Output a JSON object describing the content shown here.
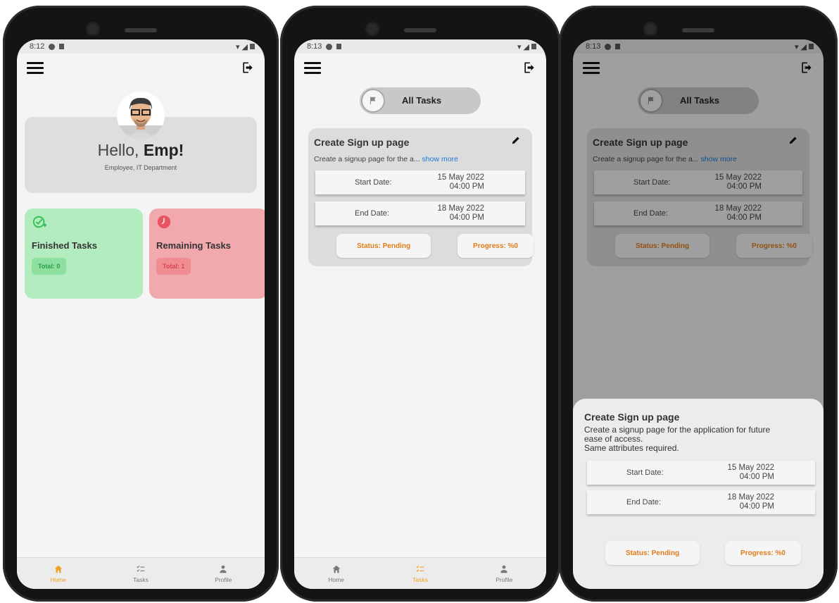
{
  "status": {
    "time1": "8:12",
    "time2": "8:13",
    "time3": "8:13"
  },
  "home": {
    "greeting": "Hello,",
    "name": "Emp!",
    "subtitle": "Employee, IT Department",
    "finished": {
      "title": "Finished Tasks",
      "total": "Total: 0"
    },
    "remaining": {
      "title": "Remaining Tasks",
      "total": "Total: 1"
    }
  },
  "nav": {
    "home": "Home",
    "tasks": "Tasks",
    "profile": "Profile"
  },
  "tasks": {
    "filter": "All Tasks",
    "card": {
      "title": "Create Sign up page",
      "desc": "Create a signup page for the a...",
      "show_more": "show more",
      "start_label": "Start Date:",
      "start_date": "15 May 2022",
      "start_time": "04:00 PM",
      "end_label": "End Date:",
      "end_date": "18 May 2022",
      "end_time": "04:00 PM",
      "status": "Status: Pending",
      "progress": "Progress: %0"
    }
  },
  "sheet": {
    "title": "Create Sign up page",
    "desc_line1": "Create a signup page for the application for future",
    "desc_line2": "ease of access.",
    "desc_line3": "Same attributes required."
  },
  "colors": {
    "accent": "#f0a020",
    "finished_bg": "#b3ecbf",
    "remaining_bg": "#f2a9ad",
    "status_text": "#e07b1a",
    "link": "#1e7ad6"
  }
}
